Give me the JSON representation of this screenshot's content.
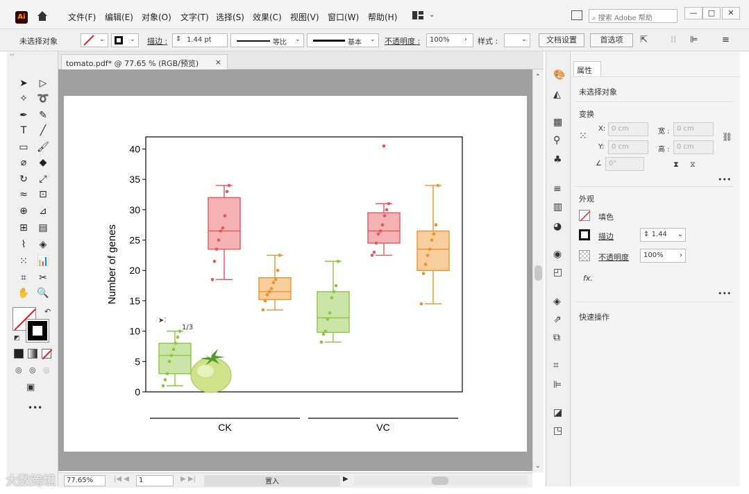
{
  "app": {
    "logo": "Ai",
    "home_icon": "home-icon"
  },
  "menu": [
    "文件(F)",
    "编辑(E)",
    "对象(O)",
    "文字(T)",
    "选择(S)",
    "效果(C)",
    "视图(V)",
    "窗口(W)",
    "帮助(H)"
  ],
  "search": {
    "placeholder": "搜索 Adobe 帮助"
  },
  "control": {
    "no_selection": "未选择对象",
    "stroke_label": "描边 :",
    "stroke_value": "1.44 pt",
    "line_style": "等比",
    "brush": "基本",
    "opacity_label": "不透明度 :",
    "opacity_value": "100%",
    "style_label": "样式 :",
    "doc_setup": "文档设置",
    "prefs": "首选项"
  },
  "document": {
    "tab_title": "tomato.pdf* @ 77.65 % (RGB/预览)",
    "close": "×"
  },
  "status": {
    "zoom": "77.65%",
    "page": "1",
    "mode": "置入"
  },
  "cursor": {
    "label": "1/3"
  },
  "chart_data": {
    "type": "box",
    "ylabel": "Number of genes",
    "ylim": [
      0,
      42
    ],
    "yticks": [
      0,
      5,
      10,
      15,
      20,
      25,
      30,
      35,
      40
    ],
    "groups": [
      "CK",
      "VC"
    ],
    "boxes": [
      {
        "group": "CK",
        "color": "#8cc63f",
        "min": 1,
        "q1": 3,
        "median": 6,
        "q3": 8,
        "max": 10,
        "points": [
          1,
          2,
          3,
          5,
          6,
          7,
          8,
          9,
          10
        ]
      },
      {
        "group": "CK",
        "color": "#e8555a",
        "min": 18.5,
        "q1": 23.5,
        "median": 26.5,
        "q3": 32,
        "max": 34,
        "points": [
          18.5,
          21.5,
          23.5,
          25,
          26.5,
          27,
          29,
          33,
          34
        ]
      },
      {
        "group": "CK",
        "color": "#f0922b",
        "min": 13.5,
        "q1": 15.2,
        "median": 16.5,
        "q3": 18.8,
        "max": 22.5,
        "points": [
          13.5,
          15,
          16,
          16.5,
          17,
          18,
          18.5,
          20,
          22.5
        ]
      },
      {
        "group": "VC",
        "color": "#8cc63f",
        "min": 8.2,
        "q1": 9.8,
        "median": 12.2,
        "q3": 16.5,
        "max": 21.5,
        "points": [
          8.2,
          9.5,
          10,
          12,
          13,
          15.5,
          16.5,
          17.5,
          21.5
        ]
      },
      {
        "group": "VC",
        "color": "#e8555a",
        "min": 22.5,
        "q1": 24.5,
        "median": 26.5,
        "q3": 29.5,
        "max": 31,
        "points": [
          22.5,
          23,
          24.5,
          26,
          26.5,
          27.5,
          29,
          30,
          31
        ],
        "outliers": [
          40.5
        ]
      },
      {
        "group": "VC",
        "color": "#f0922b",
        "min": 14.5,
        "q1": 20,
        "median": 23.5,
        "q3": 26.5,
        "max": 34,
        "points": [
          14.5,
          19.5,
          21,
          22.5,
          23.5,
          25,
          26,
          27.5,
          34
        ]
      }
    ]
  },
  "props": {
    "tab": "属性",
    "no_selection": "未选择对象",
    "transform": "变换",
    "x_label": "X:",
    "x_val": "0 cm",
    "y_label": "Y:",
    "y_val": "0 cm",
    "w_label": "宽 :",
    "w_val": "0 cm",
    "h_label": "高 :",
    "h_val": "0 cm",
    "angle": "0°",
    "appearance": "外观",
    "fill": "填色",
    "stroke": "描边",
    "stroke_val": "1.44",
    "opacity": "不透明度",
    "opacity_val": "100%",
    "fx": "fx.",
    "quick": "快速操作"
  },
  "watermark": "大数跨境"
}
